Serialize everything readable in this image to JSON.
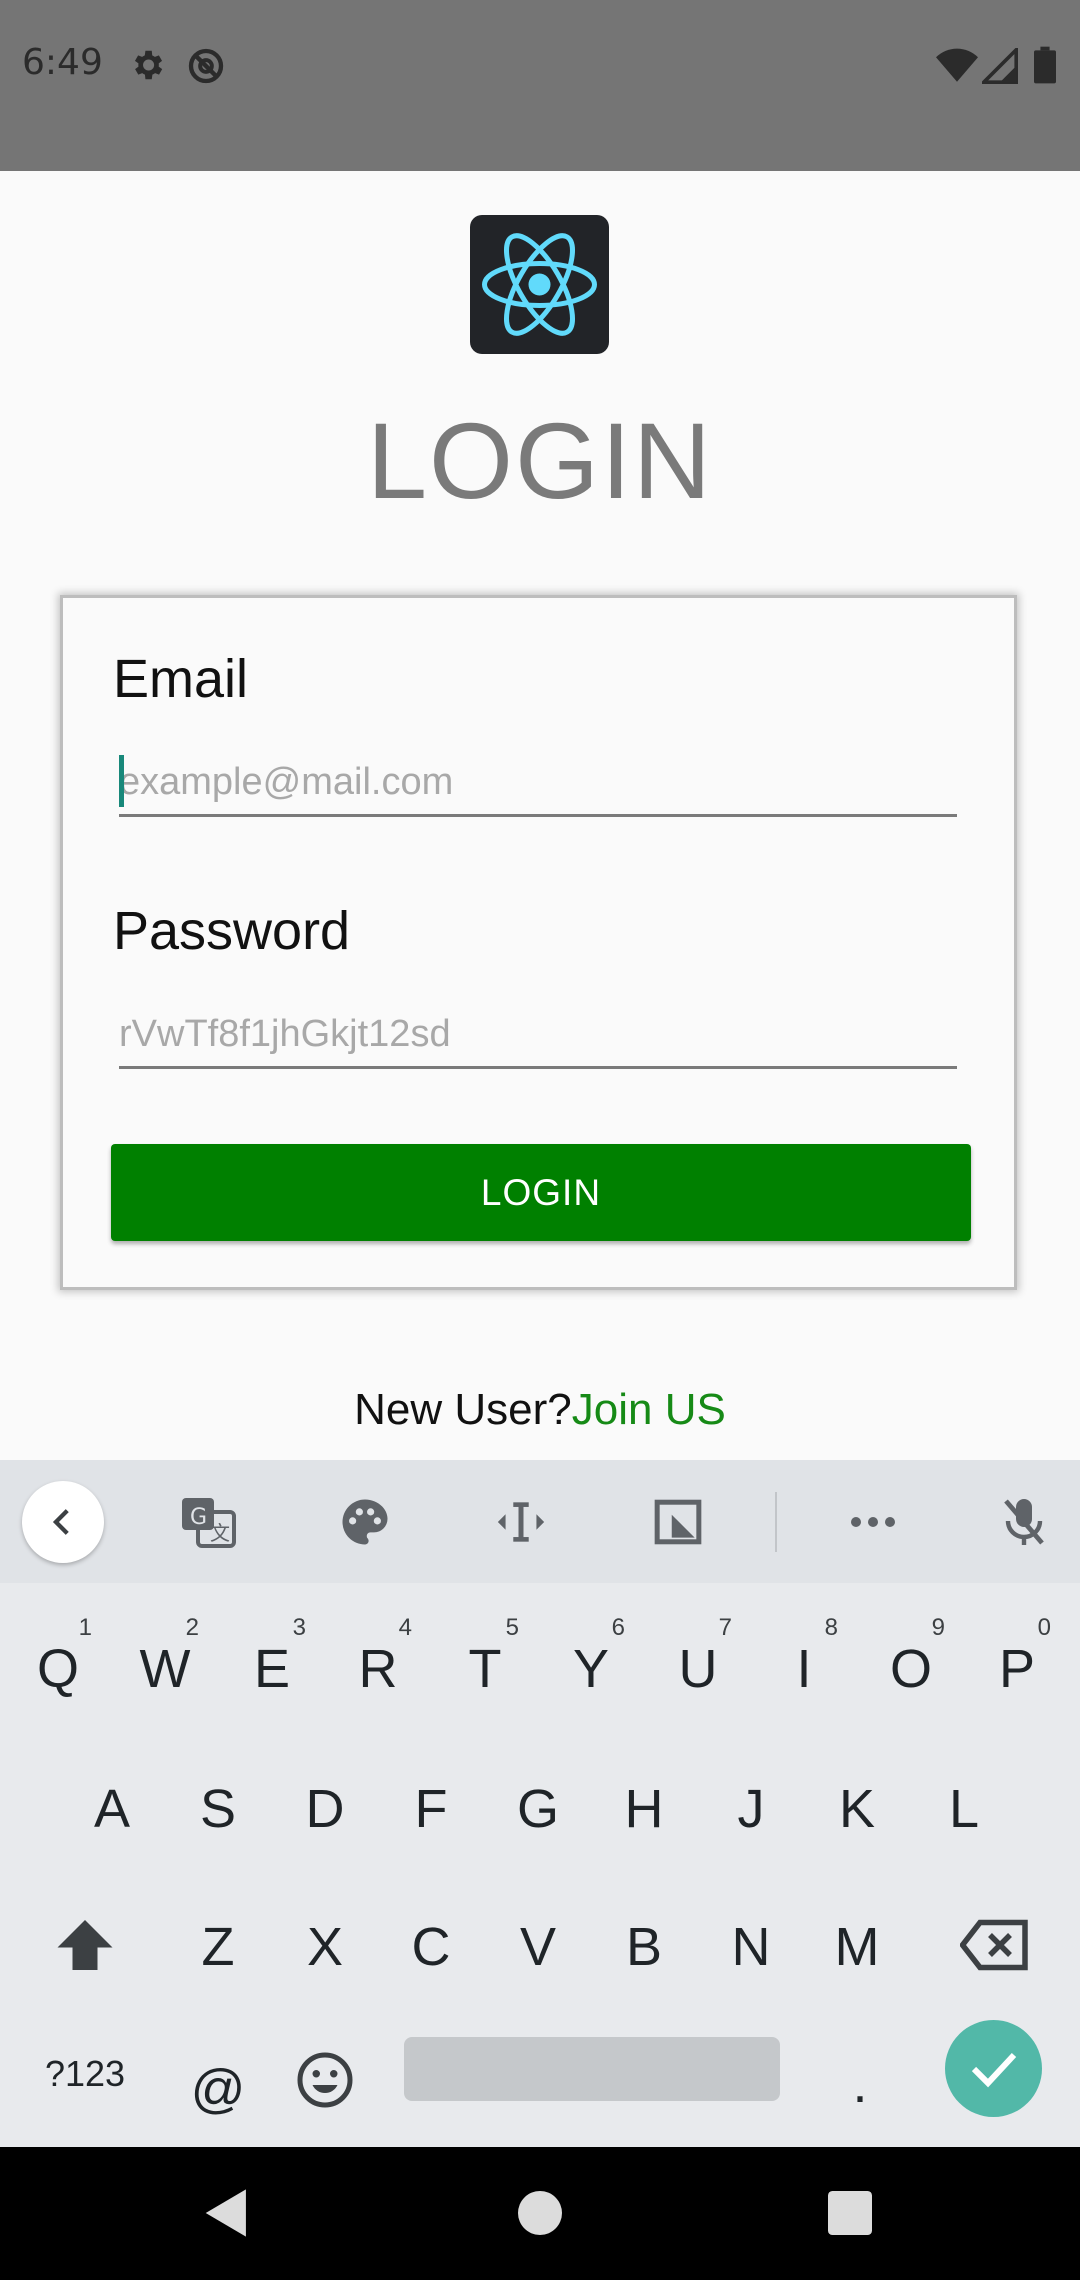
{
  "status_bar": {
    "time": "6:49",
    "left_icons": [
      "gear-icon",
      "do-not-disturb-icon"
    ],
    "right_icons": [
      "wifi-icon",
      "cellular-signal-icon",
      "battery-icon"
    ]
  },
  "app": {
    "logo_icon": "react-logo-icon",
    "title": "LOGIN",
    "form": {
      "email_label": "Email",
      "email_placeholder": "example@mail.com",
      "email_value": "",
      "password_label": "Password",
      "password_placeholder": "rVwTf8f1jhGkjt12sd",
      "password_value": "",
      "login_button": "LOGIN"
    },
    "signup": {
      "prompt": "New User?",
      "link": "Join US"
    },
    "colors": {
      "primary": "#008000",
      "link": "#168a16",
      "title": "#7a7a7a"
    }
  },
  "keyboard": {
    "toolbar": [
      "back-icon",
      "translate-icon",
      "palette-icon",
      "text-cursor-icon",
      "floating-keyboard-icon",
      "more-icon",
      "mic-off-icon"
    ],
    "row1": [
      {
        "key": "Q",
        "hint": "1"
      },
      {
        "key": "W",
        "hint": "2"
      },
      {
        "key": "E",
        "hint": "3"
      },
      {
        "key": "R",
        "hint": "4"
      },
      {
        "key": "T",
        "hint": "5"
      },
      {
        "key": "Y",
        "hint": "6"
      },
      {
        "key": "U",
        "hint": "7"
      },
      {
        "key": "I",
        "hint": "8"
      },
      {
        "key": "O",
        "hint": "9"
      },
      {
        "key": "P",
        "hint": "0"
      }
    ],
    "row2": [
      "A",
      "S",
      "D",
      "F",
      "G",
      "H",
      "J",
      "K",
      "L"
    ],
    "row3": [
      "Z",
      "X",
      "C",
      "V",
      "B",
      "N",
      "M"
    ],
    "row4": {
      "symbols": "?123",
      "at": "@",
      "emoji": "emoji-icon",
      "period": ".",
      "enter": "check-icon"
    },
    "accent": "#52b8a8"
  },
  "nav_bar": [
    "nav-back-icon",
    "nav-home-icon",
    "nav-recents-icon"
  ]
}
